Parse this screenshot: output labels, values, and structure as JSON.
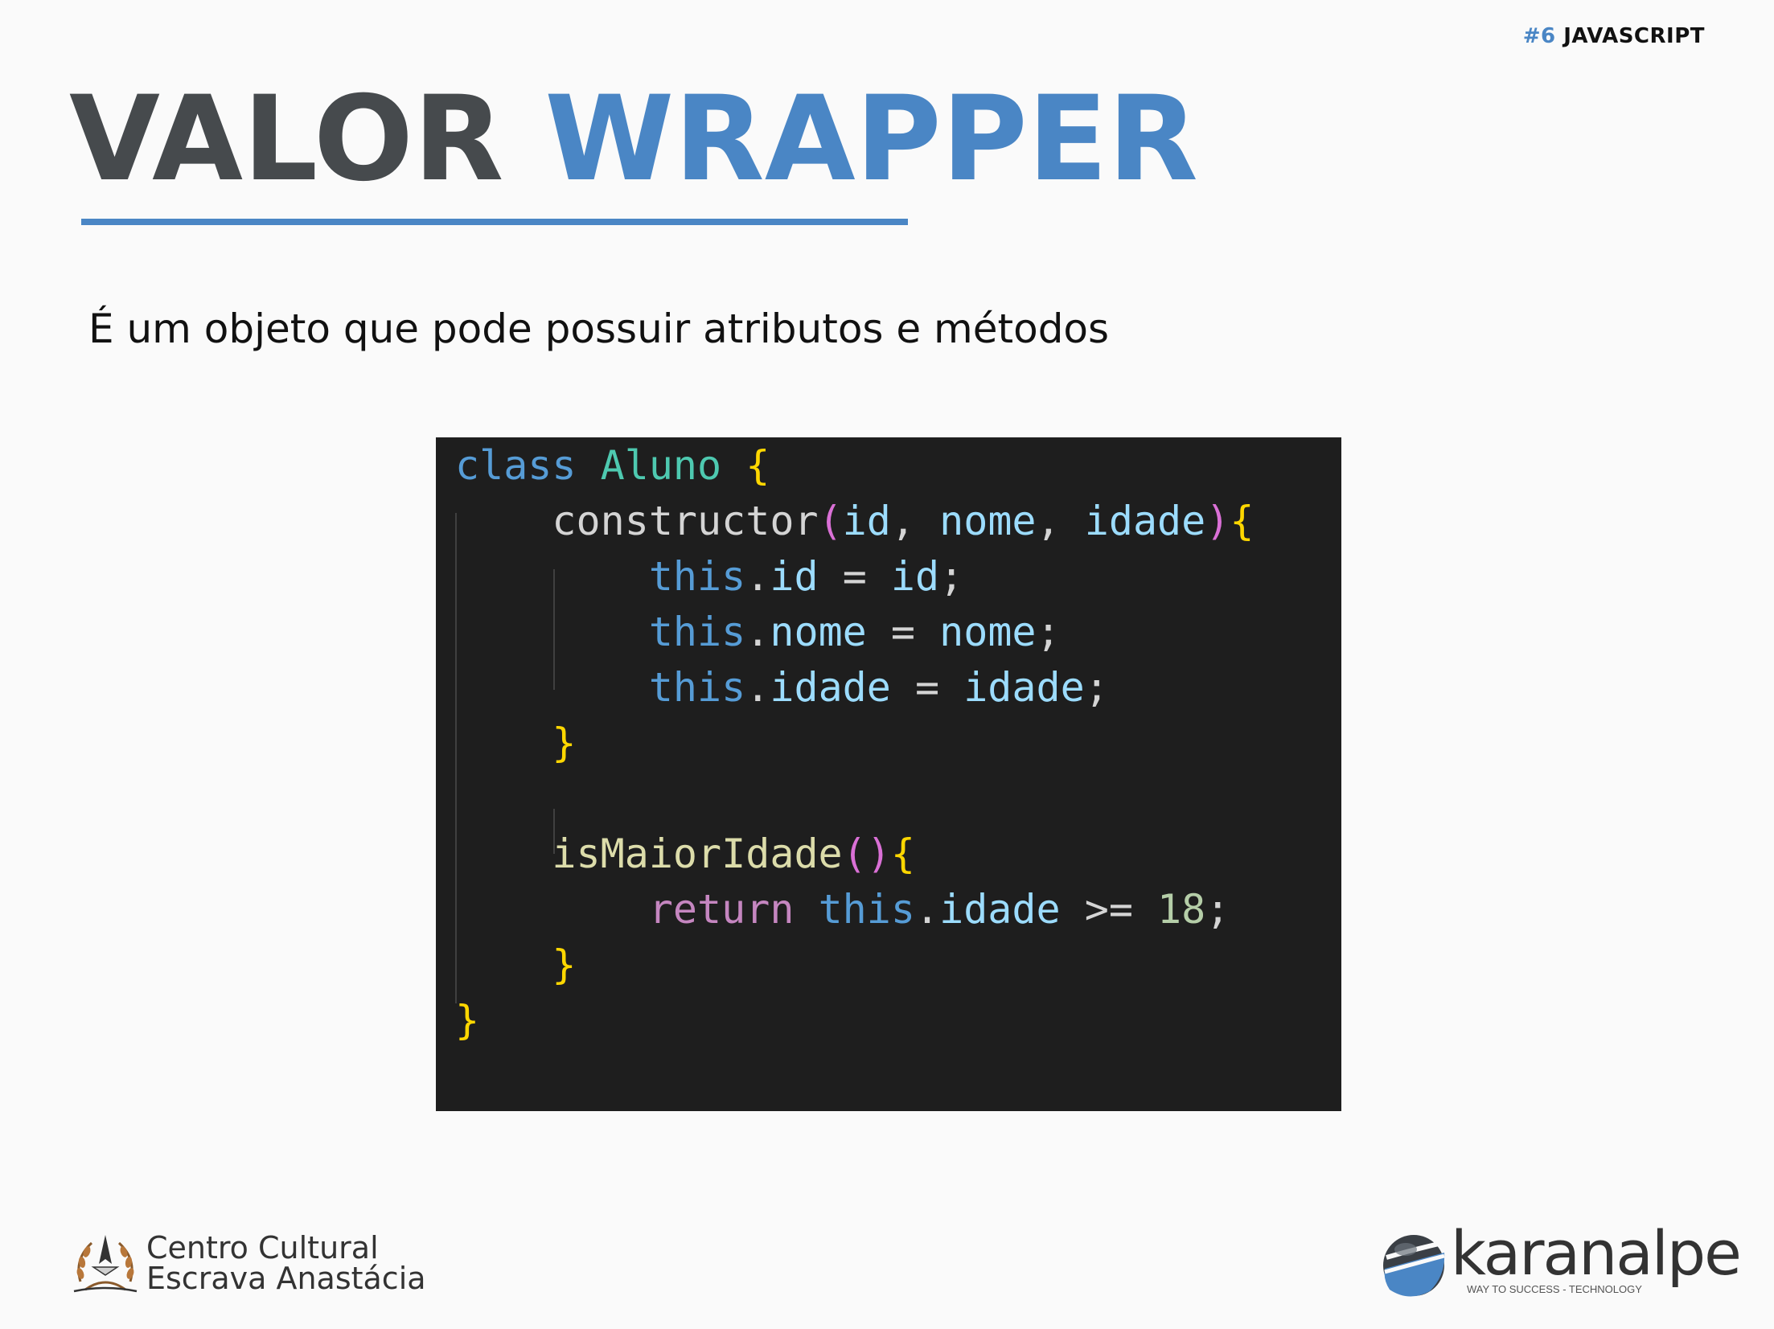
{
  "header": {
    "tag_number": "#6",
    "tag_label": "JAVASCRIPT"
  },
  "title": {
    "part1": "VALOR",
    "part2": "WRAPPER"
  },
  "subtitle": "É um objeto que pode possuir atributos e métodos",
  "code": {
    "language": "javascript",
    "lines": [
      "class Aluno {",
      "    constructor(id, nome, idade){",
      "        this.id = id;",
      "        this.nome = nome;",
      "        this.idade = idade;",
      "    }",
      "",
      "    isMaiorIdade(){",
      "        return this.idade >= 18;",
      "    }",
      "}"
    ]
  },
  "footer": {
    "left_logo_line1": "Centro Cultural",
    "left_logo_line2": "Escrava Anastácia",
    "right_logo_brand": "karanalpe",
    "right_logo_tagline": "WAY TO SUCCESS - TECHNOLOGY"
  },
  "colors": {
    "accent": "#4a86c5",
    "title_dark": "#464a4d",
    "code_background": "#1e1e1e"
  }
}
